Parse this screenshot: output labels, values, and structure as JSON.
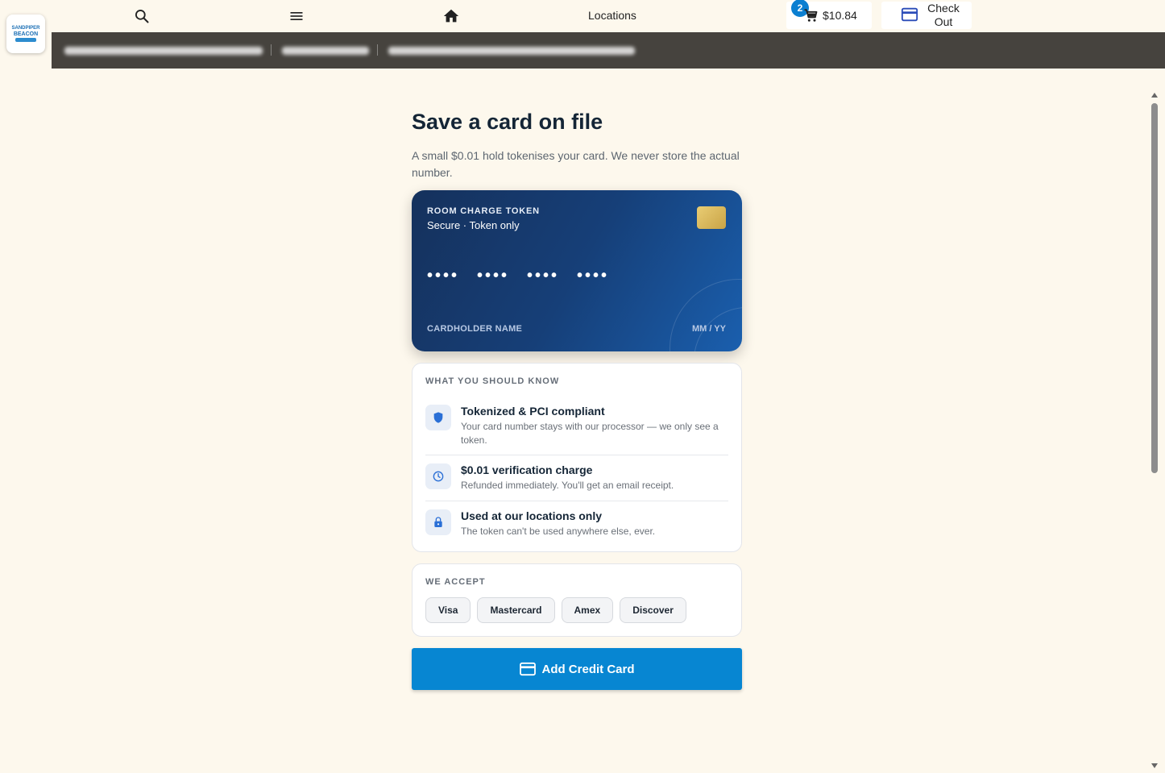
{
  "nav": {
    "locations_label": "Locations",
    "cart_count": "2",
    "cart_total": "$10.84",
    "checkout_label": "Check Out",
    "icons": [
      "search-icon",
      "menu-icon",
      "home-icon",
      "cart-icon",
      "credit-card-icon"
    ]
  },
  "logo": {
    "line1": "SANDPIPER",
    "line2": "BEACON"
  },
  "page": {
    "title": "Save a card on file",
    "subtitle": "A small $0.01 hold tokenises your card. We never store the actual number."
  },
  "card": {
    "title": "ROOM CHARGE TOKEN",
    "subtitle": "Secure · Token only",
    "number_groups": [
      "••••",
      "••••",
      "••••",
      "••••"
    ],
    "holder": "CARDHOLDER NAME",
    "expiry": "MM / YY"
  },
  "know": {
    "heading": "WHAT YOU SHOULD KNOW",
    "items": [
      {
        "title": "Tokenized & PCI compliant",
        "desc": "Your card number stays with our processor — we only see a token.",
        "icon": "shield-icon"
      },
      {
        "title": "$0.01 verification charge",
        "desc": "Refunded immediately. You'll get an email receipt.",
        "icon": "clock-icon"
      },
      {
        "title": "Used at our locations only",
        "desc": "The token can't be used anywhere else, ever.",
        "icon": "lock-icon"
      }
    ]
  },
  "accept": {
    "heading": "WE ACCEPT",
    "brands": [
      "Visa",
      "Mastercard",
      "Amex",
      "Discover"
    ]
  },
  "button": {
    "add_card": "Add Credit Card"
  },
  "colors": {
    "background": "#fdf8ed",
    "accent": "#0786d2",
    "card_dark": "#15315c",
    "info_bar": "#46433e"
  }
}
